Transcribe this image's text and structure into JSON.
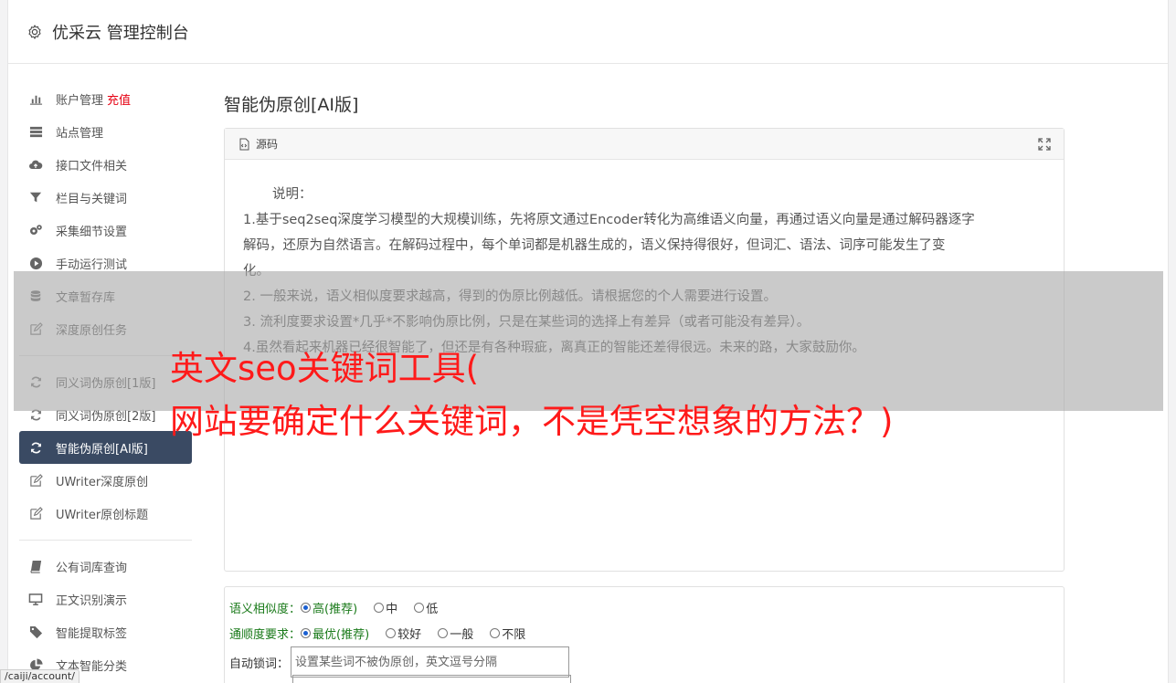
{
  "header": {
    "title": "优采云 管理控制台"
  },
  "sidebar": {
    "groups": [
      [
        {
          "label": "账户管理",
          "badge": "充值",
          "icon": "bar-chart-icon"
        },
        {
          "label": "站点管理",
          "icon": "server-icon"
        },
        {
          "label": "接口文件相关",
          "icon": "cloud-upload-icon"
        },
        {
          "label": "栏目与关键词",
          "icon": "filter-icon"
        },
        {
          "label": "采集细节设置",
          "icon": "gears-icon"
        },
        {
          "label": "手动运行测试",
          "icon": "play-circle-icon"
        },
        {
          "label": "文章暂存库",
          "icon": "database-icon"
        },
        {
          "label": "深度原创任务",
          "icon": "edit-icon"
        }
      ],
      [
        {
          "label": "同义词伪原创[1版]",
          "icon": "refresh-icon"
        },
        {
          "label": "同义词伪原创[2版]",
          "icon": "refresh-icon"
        },
        {
          "label": "智能伪原创[AI版]",
          "icon": "refresh-icon",
          "active": true
        },
        {
          "label": "UWriter深度原创",
          "icon": "edit-icon"
        },
        {
          "label": "UWriter原创标题",
          "icon": "edit-icon"
        }
      ],
      [
        {
          "label": "公有词库查询",
          "icon": "book-icon"
        },
        {
          "label": "正文识别演示",
          "icon": "monitor-icon"
        },
        {
          "label": "智能提取标签",
          "icon": "tag-icon"
        },
        {
          "label": "文本智能分类",
          "icon": "pie-chart-icon"
        }
      ]
    ]
  },
  "main": {
    "title": "智能伪原创[AI版]",
    "panel": {
      "head_label": "源码",
      "lines": [
        "说明：",
        "1.基于seq2seq深度学习模型的大规模训练，先将原文通过Encoder转化为高维语义向量，再通过语义向量是通过解码器逐字",
        "解码，还原为自然语言。在解码过程中，每个单词都是机器生成的，语义保持得很好，但词汇、语法、词序可能发生了变",
        "化。",
        "2. 一般来说，语义相似度要求越高，得到的伪原比例越低。请根据您的个人需要进行设置。",
        "3. 流利度要求设置*几乎*不影响伪原比例，只是在某些词的选择上有差异（或者可能没有差异）。",
        "4.虽然看起来机器已经很智能了，但还是有各种瑕疵，离真正的智能还差得很远。未来的路，大家鼓励你。"
      ]
    },
    "form": {
      "similarity": {
        "label": "语义相似度：",
        "options": [
          "高(推荐)",
          "中",
          "低"
        ],
        "selected": 0
      },
      "fluency": {
        "label": "通顺度要求：",
        "options": [
          "最优(推荐)",
          "较好",
          "一般",
          "不限"
        ],
        "selected": 0
      },
      "lock": {
        "label": "自动锁词：",
        "placeholder": "设置某些词不被伪原创，英文逗号分隔"
      }
    }
  },
  "overlay": {
    "line1": "英文seo关键词工具(",
    "line2": "网站要确定什么关键词，不是凭空想象的方法？)"
  },
  "status": {
    "url": "/caiji/account/"
  },
  "colors": {
    "accent": "#3a4a63",
    "badge": "#e60012",
    "headline": "#ff1a1a",
    "form_label": "#1a7a1a"
  }
}
